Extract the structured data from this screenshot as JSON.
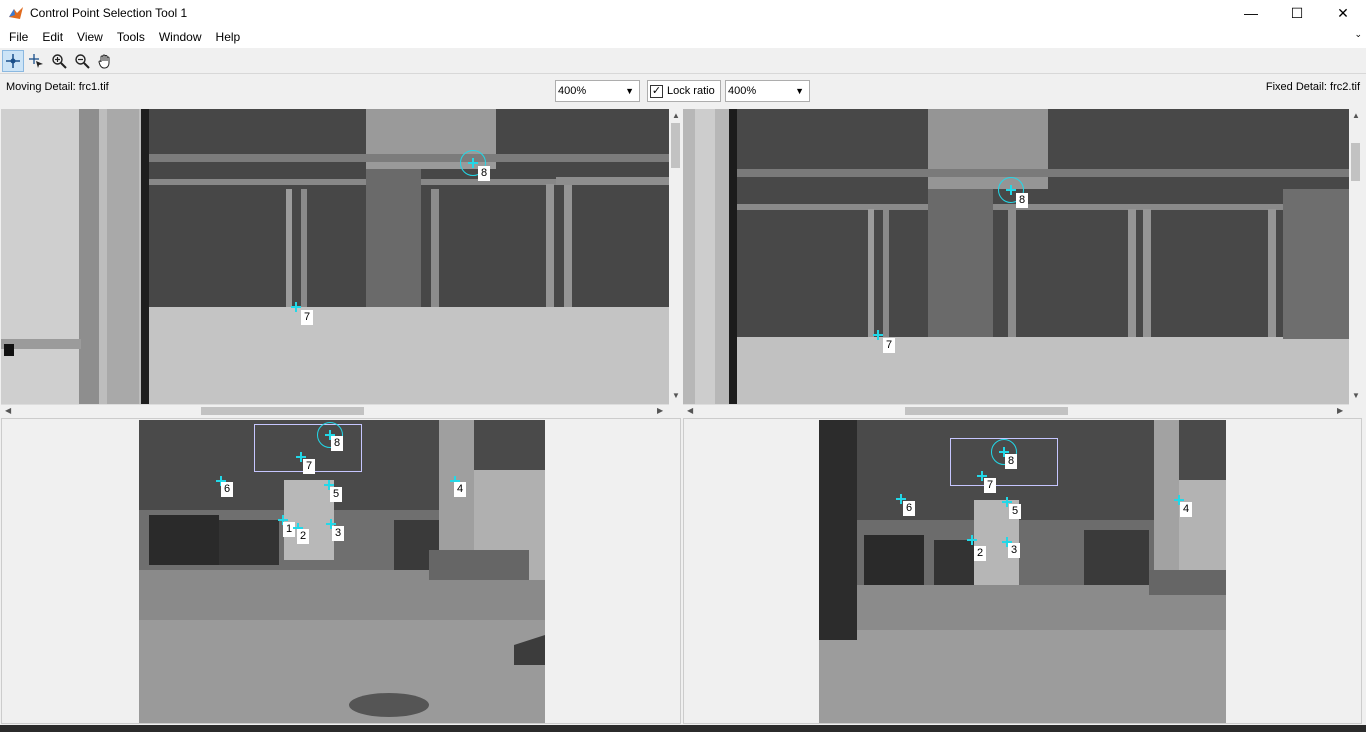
{
  "window": {
    "title": "Control Point Selection Tool 1",
    "minimize_glyph": "—",
    "maximize_glyph": "☐",
    "close_glyph": "✕"
  },
  "menu": [
    "File",
    "Edit",
    "View",
    "Tools",
    "Window",
    "Help"
  ],
  "toolbar": {
    "tools": [
      {
        "name": "add-point-icon",
        "active": true
      },
      {
        "name": "select-point-icon",
        "active": false
      },
      {
        "name": "zoom-in-icon",
        "active": false
      },
      {
        "name": "zoom-out-icon",
        "active": false
      },
      {
        "name": "pan-hand-icon",
        "active": false
      }
    ]
  },
  "detail": {
    "moving_label": "Moving Detail: frc1.tif",
    "fixed_label": "Fixed Detail: frc2.tif",
    "moving_zoom": "400%",
    "fixed_zoom": "400%",
    "lock_ratio_label": "Lock ratio",
    "lock_ratio_checked": true
  },
  "points": {
    "moving_detail": [
      "8",
      "7"
    ],
    "fixed_detail": [
      "8",
      "7"
    ],
    "moving_overview": [
      "8",
      "7",
      "6",
      "5",
      "4",
      "1",
      "2",
      "3"
    ],
    "fixed_overview": [
      "8",
      "7",
      "6",
      "5",
      "4",
      "2",
      "3"
    ]
  },
  "colors": {
    "point": "#22d8e8",
    "view_rect": "#c6c6ff"
  }
}
